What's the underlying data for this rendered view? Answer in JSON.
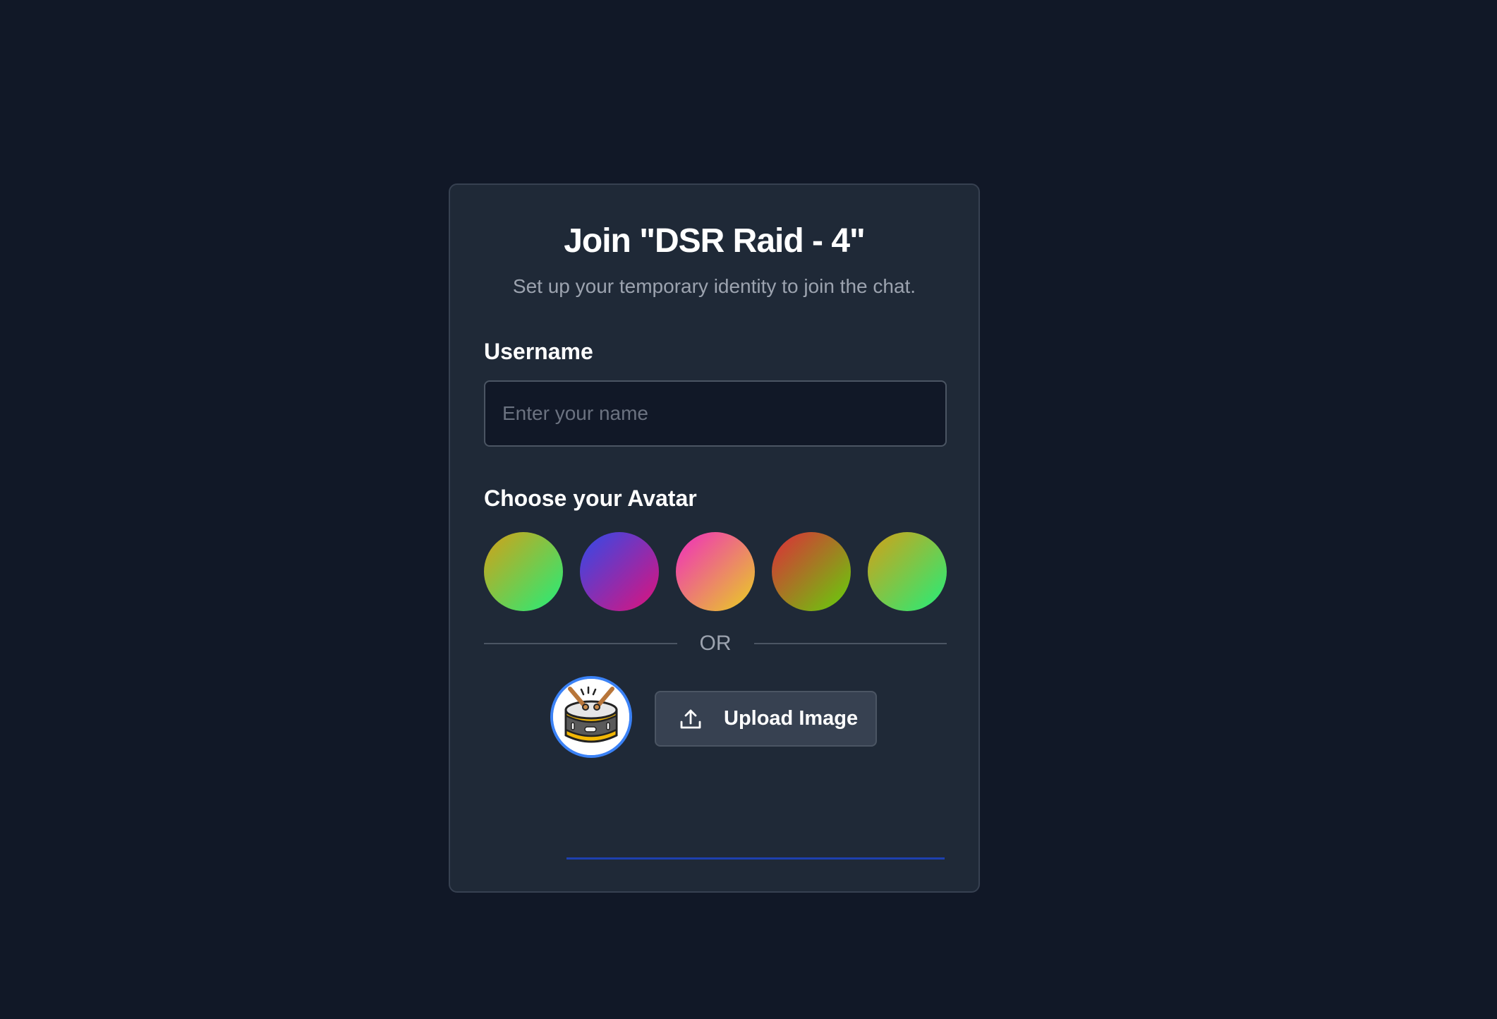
{
  "dialog": {
    "title": "Join \"DSR Raid - 4\"",
    "subtitle": "Set up your temporary identity to join the chat."
  },
  "username": {
    "label": "Username",
    "value": "",
    "placeholder": "Enter your name"
  },
  "avatar": {
    "label": "Choose your Avatar",
    "presets": [
      {
        "icon": "gradient-avatar",
        "from": "#d4a017",
        "to": "#22ee7a"
      },
      {
        "icon": "gradient-avatar",
        "from": "#2f4bea",
        "to": "#e0127a"
      },
      {
        "icon": "gradient-avatar",
        "from": "#f02cc0",
        "to": "#e8d020"
      },
      {
        "icon": "gradient-avatar",
        "from": "#e02a3a",
        "to": "#62d20a"
      },
      {
        "icon": "gradient-avatar",
        "from": "#d4a017",
        "to": "#22ee7a"
      }
    ],
    "separator": "OR",
    "selected_icon": "drum-icon",
    "upload_label": "Upload Image",
    "upload_icon": "upload-icon"
  },
  "colors": {
    "background": "#111827",
    "card": "#1f2937",
    "accent": "#3b82f6"
  }
}
